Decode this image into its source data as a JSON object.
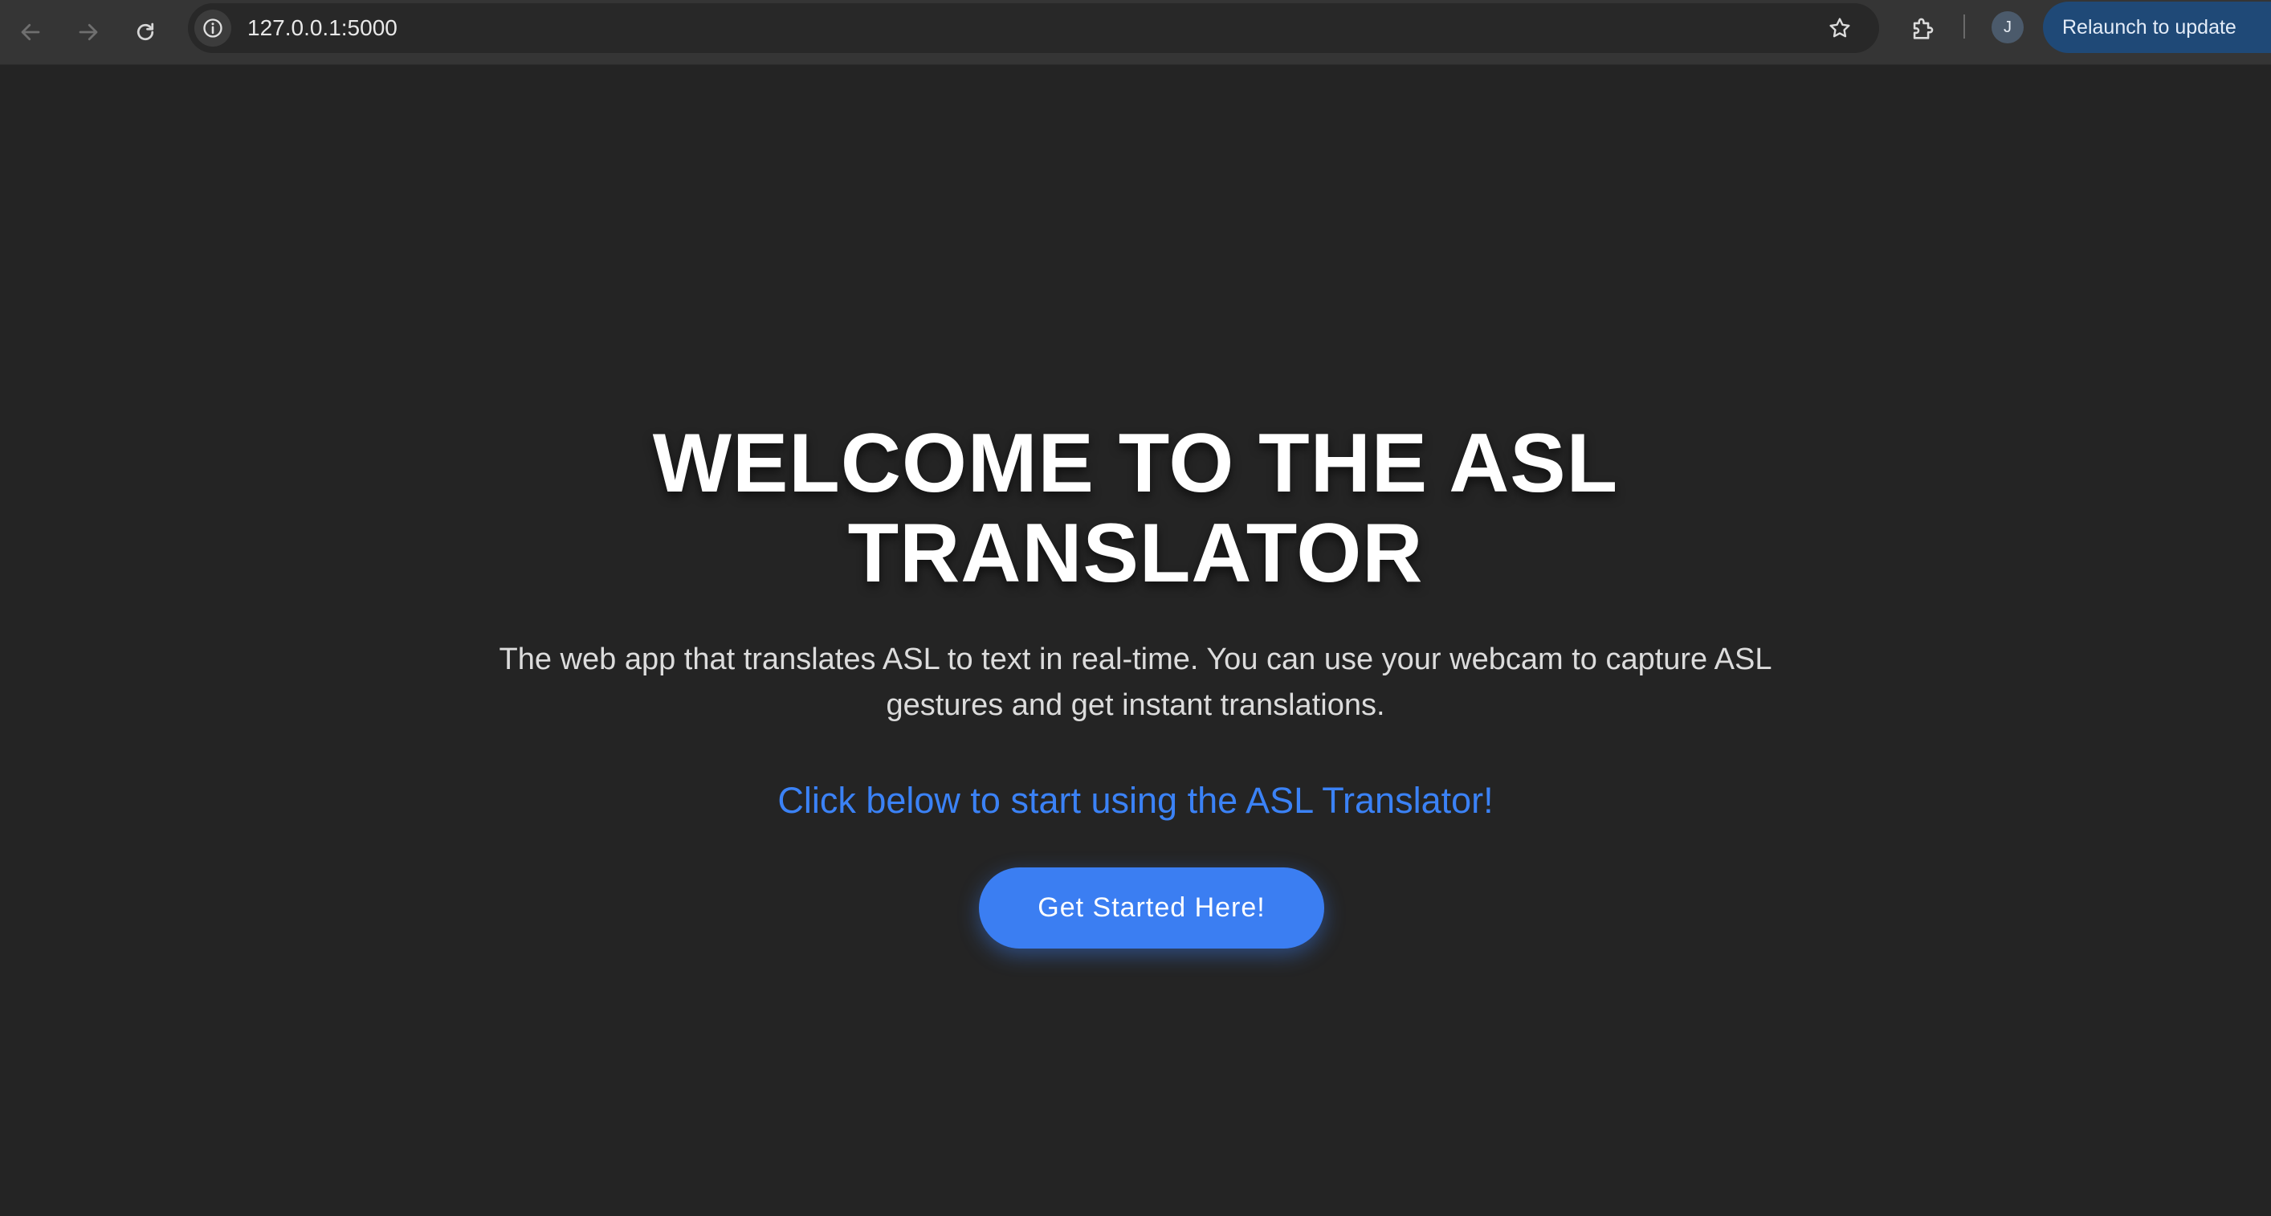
{
  "browser": {
    "url": "127.0.0.1:5000",
    "profile_initial": "J",
    "relaunch_label": "Relaunch to update",
    "icons": [
      "back-arrow-icon",
      "forward-arrow-icon",
      "reload-icon",
      "site-info-icon",
      "bookmark-star-icon",
      "extensions-puzzle-icon"
    ]
  },
  "page": {
    "title_line1": "WELCOME TO THE ASL",
    "title_line2": "TRANSLATOR",
    "description": "The web app that translates ASL to text in real-time. You can use your webcam to capture ASL gestures and get instant translations.",
    "cta_text": "Click below to start using the ASL Translator!",
    "cta_button_label": "Get Started Here!"
  },
  "colors": {
    "background": "#242424",
    "accent": "#3b82f6",
    "button": "#3b7ef2",
    "toolbar": "#353535"
  }
}
